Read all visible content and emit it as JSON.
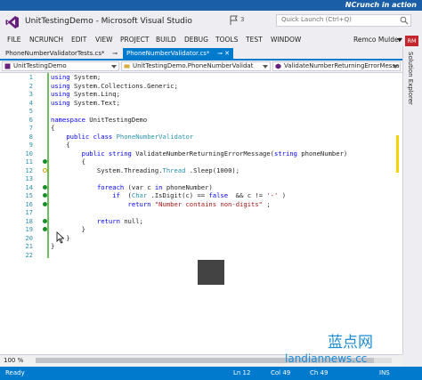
{
  "banner": {
    "text": "NCrunch in action"
  },
  "window": {
    "title": "UnitTestingDemo - Microsoft Visual Studio",
    "flag_count": "3"
  },
  "quick_launch": {
    "placeholder": "Quick Launch (Ctrl+Q)"
  },
  "menu": [
    "FILE",
    "NCRUNCH",
    "EDIT",
    "VIEW",
    "PROJECT",
    "BUILD",
    "DEBUG",
    "TOOLS",
    "TEST",
    "WINDOW"
  ],
  "user": {
    "name": "Remco Mulder",
    "initials": "RM"
  },
  "tabs": [
    {
      "label": "PhoneNumberValidatorTests.cs*",
      "active": false
    },
    {
      "label": "PhoneNumberValidator.cs*",
      "active": true
    }
  ],
  "nav": {
    "project": "UnitTestingDemo",
    "class": "UnitTestingDemo.PhoneNumberValidat",
    "member": "ValidateNumberReturningErrorMessage"
  },
  "code_lines": [
    {
      "n": "1",
      "tokens": [
        [
          "kw",
          "using"
        ],
        [
          "",
          "System;"
        ]
      ]
    },
    {
      "n": "2",
      "tokens": [
        [
          "kw",
          "using"
        ],
        [
          "",
          "System.Collections.Generic;"
        ]
      ]
    },
    {
      "n": "3",
      "tokens": [
        [
          "kw",
          "using"
        ],
        [
          "",
          "System.Linq;"
        ]
      ]
    },
    {
      "n": "4",
      "tokens": [
        [
          "kw",
          "using"
        ],
        [
          "",
          "System.Text;"
        ]
      ]
    },
    {
      "n": "5",
      "tokens": []
    },
    {
      "n": "6",
      "tokens": [
        [
          "kw",
          "namespace"
        ],
        [
          "",
          "UnitTestingDemo"
        ]
      ]
    },
    {
      "n": "7",
      "tokens": [
        [
          "",
          "{"
        ]
      ]
    },
    {
      "n": "8",
      "tokens": [
        [
          "",
          "    "
        ],
        [
          "kw",
          "public class"
        ],
        [
          "ty",
          "PhoneNumberValidator"
        ]
      ]
    },
    {
      "n": "9",
      "tokens": [
        [
          "",
          "    {"
        ]
      ]
    },
    {
      "n": "10",
      "tokens": [
        [
          "",
          "        "
        ],
        [
          "kw",
          "public string"
        ],
        [
          "",
          "ValidateNumberReturningErrorMessage("
        ],
        [
          "kw",
          "string"
        ],
        [
          "",
          "phoneNumber)"
        ]
      ]
    },
    {
      "n": "11",
      "tokens": [
        [
          "",
          "        {"
        ]
      ]
    },
    {
      "n": "12",
      "tokens": [
        [
          "",
          "            System.Threading."
        ],
        [
          "ty",
          "Thread"
        ],
        [
          "",
          ".Sleep(1000);"
        ]
      ]
    },
    {
      "n": "13",
      "tokens": []
    },
    {
      "n": "14",
      "tokens": [
        [
          "",
          "            "
        ],
        [
          "kw",
          "foreach"
        ],
        [
          "",
          ""
        ],
        [
          "",
          "(var c "
        ],
        [
          "kw",
          "in"
        ],
        [
          "",
          "phoneNumber)"
        ]
      ]
    },
    {
      "n": "15",
      "tokens": [
        [
          "",
          "                "
        ],
        [
          "kw",
          "if"
        ],
        [
          "",
          " ("
        ],
        [
          "ty",
          "Char"
        ],
        [
          "",
          ".IsDigit(c) == "
        ],
        [
          "kw",
          "false"
        ],
        [
          "",
          " && c != "
        ],
        [
          "st",
          "'-'"
        ],
        [
          "",
          ")"
        ]
      ]
    },
    {
      "n": "16",
      "tokens": [
        [
          "",
          "                    "
        ],
        [
          "kw",
          "return"
        ],
        [
          "st",
          "\"Number contains non-digits\""
        ],
        [
          "",
          ";"
        ]
      ]
    },
    {
      "n": "17",
      "tokens": []
    },
    {
      "n": "18",
      "tokens": [
        [
          "",
          "            "
        ],
        [
          "kw",
          "return"
        ],
        [
          "",
          "null;"
        ]
      ]
    },
    {
      "n": "19",
      "tokens": [
        [
          "",
          "        }"
        ]
      ]
    },
    {
      "n": "20",
      "tokens": [
        [
          "",
          "    }"
        ]
      ]
    },
    {
      "n": "21",
      "tokens": [
        [
          "",
          "}"
        ]
      ]
    },
    {
      "n": "22",
      "tokens": []
    }
  ],
  "coverage_markers": {
    "green": [
      "11",
      "14",
      "15",
      "16",
      "18",
      "19"
    ],
    "outline": [
      "12"
    ]
  },
  "sidebar": {
    "label": "Solution Explorer"
  },
  "zoom": "100 %",
  "status": {
    "ready": "Ready",
    "ln": "Ln 12",
    "col": "Col 49",
    "ch": "Ch 49",
    "ins": "INS"
  },
  "watermark": {
    "top": "蓝点网",
    "bottom": "landiannews.cc"
  },
  "colors": {
    "accent": "#007acc",
    "banner": "#1b5ea8",
    "coverage_green": "#1e8c2a",
    "rm_badge": "#c4262e"
  }
}
